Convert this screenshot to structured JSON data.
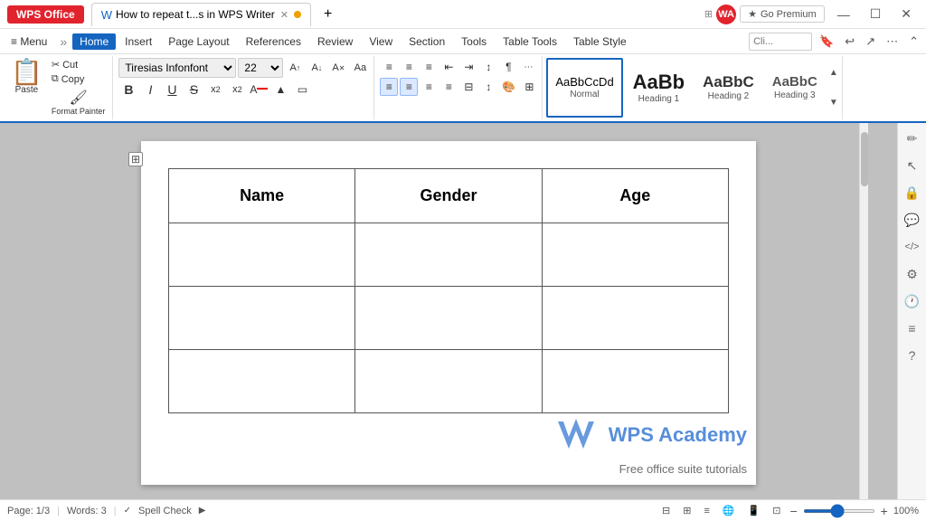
{
  "titleBar": {
    "wpsLabel": "WPS Office",
    "tabTitle": "How to repeat t...s in WPS Writer",
    "newTabLabel": "+",
    "goPremium": "Go Premium",
    "userInitials": "WA",
    "winBtns": [
      "—",
      "☐",
      "✕"
    ]
  },
  "menuBar": {
    "hamburger": "≡ Menu",
    "items": [
      "Home",
      "Insert",
      "Page Layout",
      "References",
      "Review",
      "View",
      "Section",
      "Tools",
      "Table Tools",
      "Table Style"
    ],
    "activeItem": "Home",
    "more": "»",
    "search": "Cli...",
    "icons": [
      "🔖",
      "↩",
      "⚙"
    ]
  },
  "toolbar": {
    "clipboard": {
      "pasteLabel": "Paste",
      "cutLabel": "Cut",
      "copyLabel": "Copy",
      "formatPainterLabel": "Format Painter"
    },
    "font": {
      "fontName": "Tiresias Infonfont",
      "fontSize": "22",
      "growLabel": "A↑",
      "shrinkLabel": "A↓",
      "clearLabel": "A✕",
      "caseLabel": "Aa",
      "boldLabel": "B",
      "italicLabel": "I",
      "underlineLabel": "U",
      "strikeLabel": "S",
      "superLabel": "x²",
      "subLabel": "x₂",
      "fontColorLabel": "A",
      "highlightLabel": "▲",
      "borderLabel": "▭"
    },
    "paragraph": {
      "bullets1": "≡",
      "bullets2": "≡",
      "indent1": "⇤",
      "indent2": "⇥",
      "sort": "↕",
      "pilcrow": "¶",
      "more": "⋯"
    },
    "styles": {
      "items": [
        {
          "label": "Normal",
          "preview": "AaBbCcDd",
          "selected": true
        },
        {
          "label": "Heading 1",
          "preview": "AaBb"
        },
        {
          "label": "Heading 2",
          "preview": "AaBbC"
        },
        {
          "label": "Heading 3",
          "preview": "AaBbC"
        }
      ]
    }
  },
  "document": {
    "table": {
      "headers": [
        "Name",
        "Gender",
        "Age"
      ],
      "rows": [
        [
          "",
          "",
          ""
        ],
        [
          "",
          "",
          ""
        ],
        [
          "",
          "",
          ""
        ]
      ]
    }
  },
  "statusBar": {
    "page": "Page: 1/3",
    "words": "Words: 3",
    "spellCheck": "Spell Check",
    "zoom": "100%",
    "zoomValue": 100
  },
  "rightSidebar": {
    "icons": [
      "✏",
      "↖",
      "🔒",
      "💬",
      "</>",
      "⚙",
      "🕐",
      "≡",
      "?"
    ]
  },
  "watermark": {
    "brandName": "WPS Academy",
    "tagline": "Free office suite tutorials"
  }
}
